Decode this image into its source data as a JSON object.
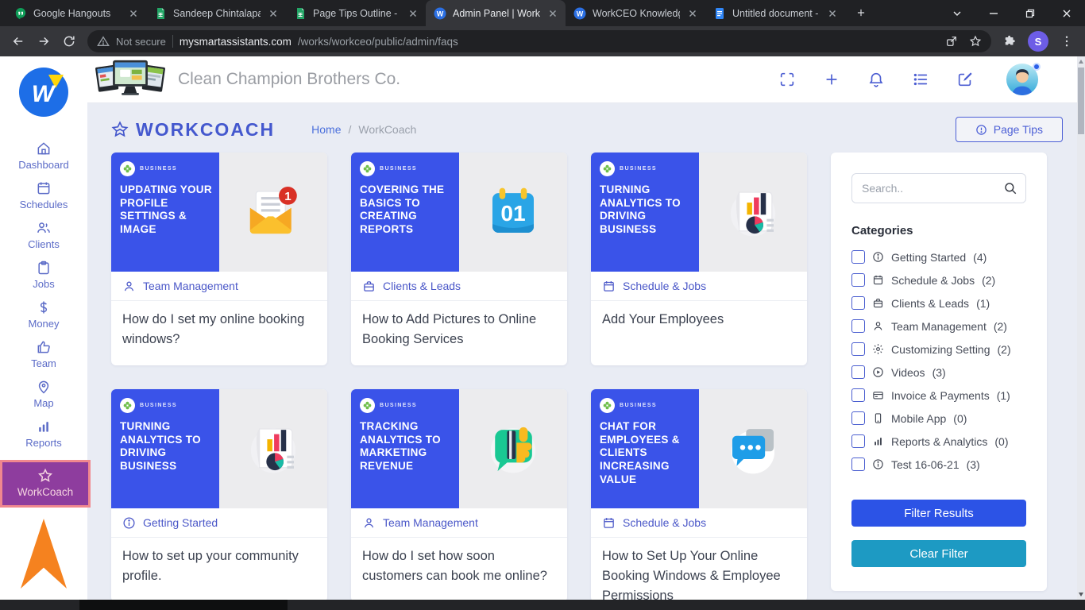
{
  "browser": {
    "tabs": [
      {
        "title": "Google Hangouts",
        "icon": "hangouts-icon",
        "active": false
      },
      {
        "title": "Sandeep Chintalapalle",
        "icon": "sheets-icon",
        "active": false
      },
      {
        "title": "Page Tips Outline - Go",
        "icon": "sheets-icon",
        "active": false
      },
      {
        "title": "Admin Panel | WorkC",
        "icon": "workceo-icon",
        "active": true
      },
      {
        "title": "WorkCEO Knowledge",
        "icon": "workceo-icon",
        "active": false
      },
      {
        "title": "Untitled document - G",
        "icon": "docs-icon",
        "active": false
      }
    ],
    "address": {
      "security_label": "Not secure",
      "domain": "mysmartassistants.com",
      "path": "/works/workceo/public/admin/faqs"
    },
    "profile_initial": "S"
  },
  "sidebar": {
    "items": [
      {
        "label": "Dashboard",
        "icon": "home-icon",
        "active": false
      },
      {
        "label": "Schedules",
        "icon": "calendar-icon",
        "active": false
      },
      {
        "label": "Clients",
        "icon": "people-icon",
        "active": false
      },
      {
        "label": "Jobs",
        "icon": "clipboard-icon",
        "active": false
      },
      {
        "label": "Money",
        "icon": "dollar-icon",
        "active": false
      },
      {
        "label": "Team",
        "icon": "thumbs-up-icon",
        "active": false
      },
      {
        "label": "Map",
        "icon": "map-pin-icon",
        "active": false
      },
      {
        "label": "Reports",
        "icon": "bar-chart-icon",
        "active": false
      },
      {
        "label": "WorkCoach",
        "icon": "star-icon",
        "active": true
      }
    ]
  },
  "header": {
    "company_name": "Clean Champion Brothers Co."
  },
  "page": {
    "title": "WORKCOACH",
    "breadcrumb": {
      "home": "Home",
      "separator": "/",
      "current": "WorkCoach"
    },
    "page_tips_label": "Page Tips"
  },
  "cards": [
    {
      "thumb_badge": "BUSINESS",
      "thumb_title": "UPDATING YOUR PROFILE SETTINGS & IMAGE",
      "thumb_icon": "email-notification-icon",
      "category": "Team Management",
      "category_icon": "person-icon",
      "question": "How do I set my online booking windows?"
    },
    {
      "thumb_badge": "BUSINESS",
      "thumb_title": "COVERING THE BASICS TO CREATING REPORTS",
      "thumb_icon": "calendar-01-icon",
      "category": "Clients & Leads",
      "category_icon": "briefcase-icon",
      "question": "How to Add Pictures to Online Booking Services"
    },
    {
      "thumb_badge": "BUSINESS",
      "thumb_title": "TURNING ANALYTICS TO DRIVING BUSINESS",
      "thumb_icon": "report-chart-icon",
      "category": "Schedule & Jobs",
      "category_icon": "calendar-icon",
      "question": "Add Your Employees"
    },
    {
      "thumb_badge": "BUSINESS",
      "thumb_title": "TURNING ANALYTICS TO DRIVING BUSINESS",
      "thumb_icon": "report-chart-icon",
      "category": "Getting Started",
      "category_icon": "info-icon",
      "question": "How to set up your community profile."
    },
    {
      "thumb_badge": "BUSINESS",
      "thumb_title": "TRACKING ANALYTICS TO MARKETING REVENUE",
      "thumb_icon": "thumbs-up-bubble-icon",
      "category": "Team Management",
      "category_icon": "person-icon",
      "question": "How do I set how soon customers can book me online?"
    },
    {
      "thumb_badge": "BUSINESS",
      "thumb_title": "CHAT FOR EMPLOYEES & CLIENTS INCREASING VALUE",
      "thumb_icon": "chat-dots-icon",
      "category": "Schedule & Jobs",
      "category_icon": "calendar-icon",
      "question": "How to Set Up Your Online Booking Windows & Employee Permissions"
    }
  ],
  "filter": {
    "search_placeholder": "Search..",
    "categories_title": "Categories",
    "categories": [
      {
        "label": "Getting Started",
        "count_text": "(4)",
        "icon": "info-icon"
      },
      {
        "label": "Schedule & Jobs",
        "count_text": "(2)",
        "icon": "calendar-icon"
      },
      {
        "label": "Clients & Leads",
        "count_text": "(1)",
        "icon": "briefcase-icon"
      },
      {
        "label": "Team Management",
        "count_text": "(2)",
        "icon": "person-icon"
      },
      {
        "label": "Customizing Setting",
        "count_text": "(2)",
        "icon": "gear-icon"
      },
      {
        "label": "Videos",
        "count_text": "(3)",
        "icon": "play-icon"
      },
      {
        "label": "Invoice & Payments",
        "count_text": "(1)",
        "icon": "credit-card-icon"
      },
      {
        "label": "Mobile App",
        "count_text": "(0)",
        "icon": "mobile-icon"
      },
      {
        "label": "Reports & Analytics",
        "count_text": "(0)",
        "icon": "bar-chart-icon"
      },
      {
        "label": "Test 16-06-21",
        "count_text": "(3)",
        "icon": "info-icon"
      }
    ],
    "filter_button": "Filter Results",
    "clear_button": "Clear Filter"
  },
  "colors": {
    "accent_blue": "#4458ce",
    "thumbnail_blue": "#3a53e9",
    "active_nav_purple": "#8e3d9e",
    "active_nav_border": "#f0888f",
    "arrow_orange": "#f5821f",
    "filter_button_blue": "#2c53e6",
    "clear_button_teal": "#1d9ac3",
    "notification_red": "#d93025"
  }
}
